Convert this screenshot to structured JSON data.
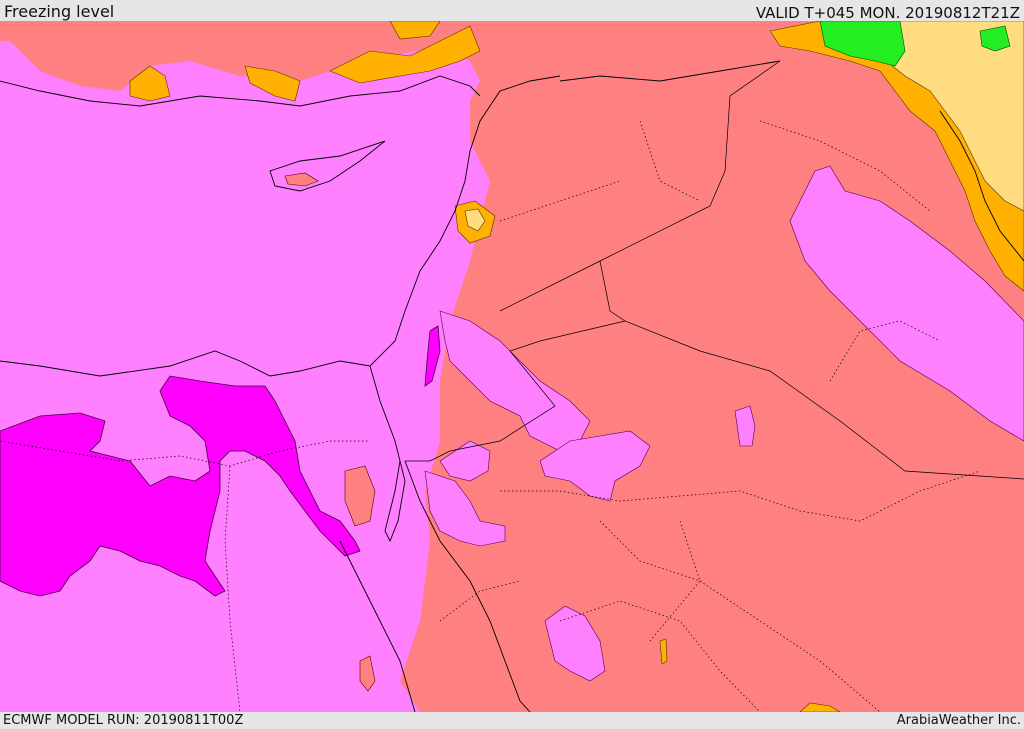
{
  "header": {
    "title": "Freezing level",
    "valid_time": "VALID T+045 MON. 20190812T21Z"
  },
  "footer": {
    "model_run": "ECMWF MODEL RUN: 20190811T00Z",
    "credit": "ArabiaWeather Inc."
  },
  "colors": {
    "low_freezing_magenta": "#ff80ff",
    "very_low_magenta": "#ff00ff",
    "mid_salmon": "#ff8080",
    "high_orange": "#ffb000",
    "higher_pale_yellow": "#ffdc80",
    "highest_green": "#22ee22",
    "coastline": "#000000",
    "border_dotted": "#000000"
  }
}
